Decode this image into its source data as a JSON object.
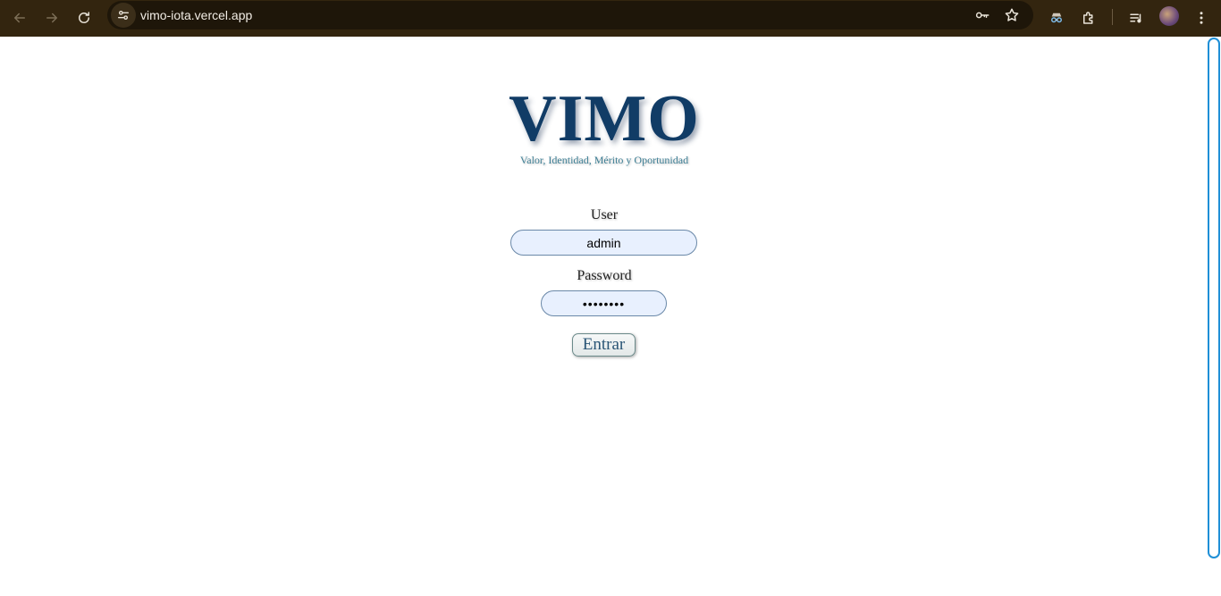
{
  "browser": {
    "url": "vimo-iota.vercel.app",
    "icons": {
      "back": "arrow-left-icon",
      "forward": "arrow-right-icon",
      "reload": "reload-icon",
      "site_info": "tune-icon",
      "password_manager": "key-icon",
      "bookmark": "star-icon",
      "incognito": "incognito-icon",
      "extensions": "puzzle-icon",
      "media": "media-queue-icon",
      "menu": "more-vert-icon"
    },
    "colors": {
      "toolbar_bg": "#33250f",
      "omnibox_bg": "#1e1609"
    }
  },
  "app": {
    "title": "VIMO",
    "tagline": "Valor, Identidad, Mérito y Oportunidad",
    "colors": {
      "brand": "#113c66",
      "tagline": "#3e7f95",
      "input_bg": "#e8f0fe"
    }
  },
  "login": {
    "user_label": "User",
    "user_value": "admin",
    "password_label": "Password",
    "password_value": "admin123",
    "submit_label": "Entrar"
  }
}
